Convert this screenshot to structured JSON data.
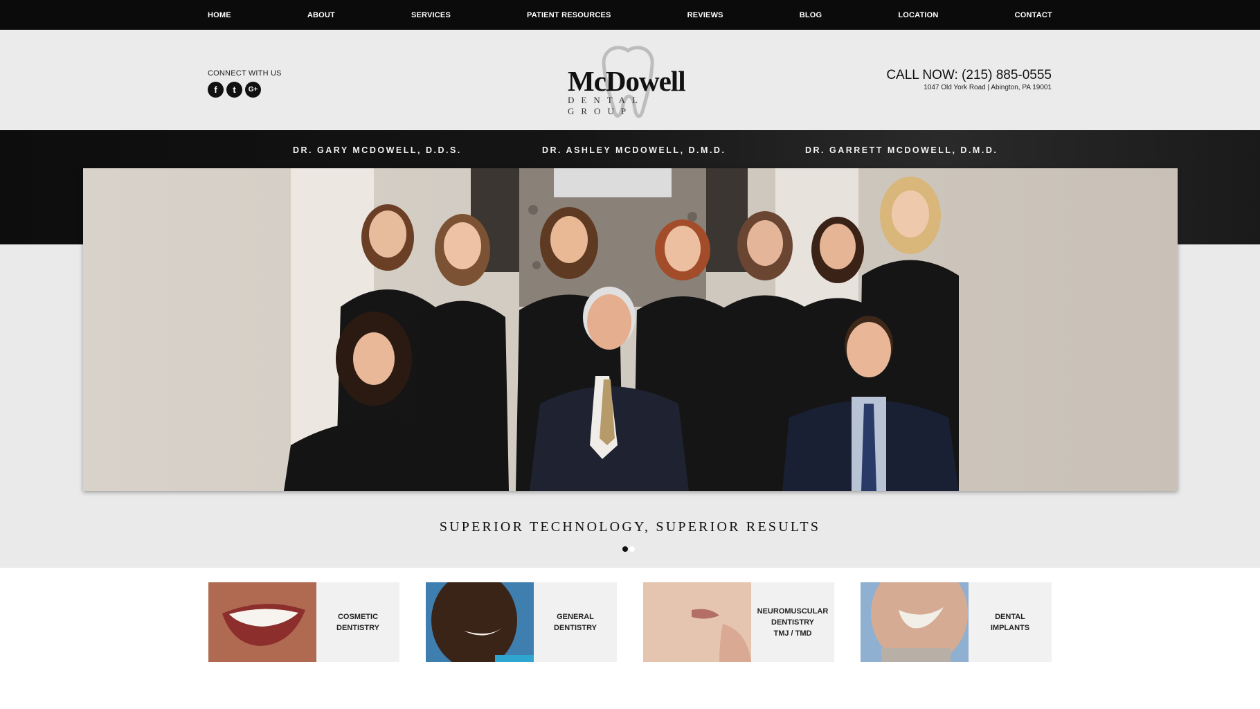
{
  "nav": {
    "items": [
      "HOME",
      "ABOUT",
      "SERVICES",
      "PATIENT RESOURCES",
      "REVIEWS",
      "BLOG",
      "LOCATION",
      "CONTACT"
    ]
  },
  "header": {
    "connect_label": "CONNECT WITH US",
    "social": [
      {
        "icon": "facebook-icon",
        "glyph": "f"
      },
      {
        "icon": "twitter-icon",
        "glyph": "t"
      },
      {
        "icon": "google-plus-icon",
        "glyph": "G+"
      }
    ],
    "logo_main": "McDowell",
    "logo_sub": "DENTAL GROUP",
    "call_now": "CALL NOW: (215) 885-0555",
    "address": "1047 Old York Road | Abington, PA 19001"
  },
  "doctors": [
    "DR. GARY MCDOWELL, D.D.S.",
    "DR. ASHLEY MCDOWELL, D.M.D.",
    "DR. GARRETT MCDOWELL, D.M.D."
  ],
  "hero": {
    "tagline": "SUPERIOR TECHNOLOGY, SUPERIOR RESULTS",
    "slides": 2,
    "active_slide": 1
  },
  "services": [
    {
      "label": "COSMETIC\nDENTISTRY",
      "image": "smile-photo"
    },
    {
      "label": "GENERAL\nDENTISTRY",
      "image": "child-smile-photo"
    },
    {
      "label": "NEUROMUSCULAR\nDENTISTRY\nTMJ / TMD",
      "image": "jaw-photo"
    },
    {
      "label": "DENTAL\nIMPLANTS",
      "image": "senior-smile-photo"
    }
  ],
  "colors": {
    "nav_bg": "#0b0b0b",
    "header_bg": "#ecebeb",
    "band_bg": "#151515",
    "scrubs": "#151515"
  }
}
